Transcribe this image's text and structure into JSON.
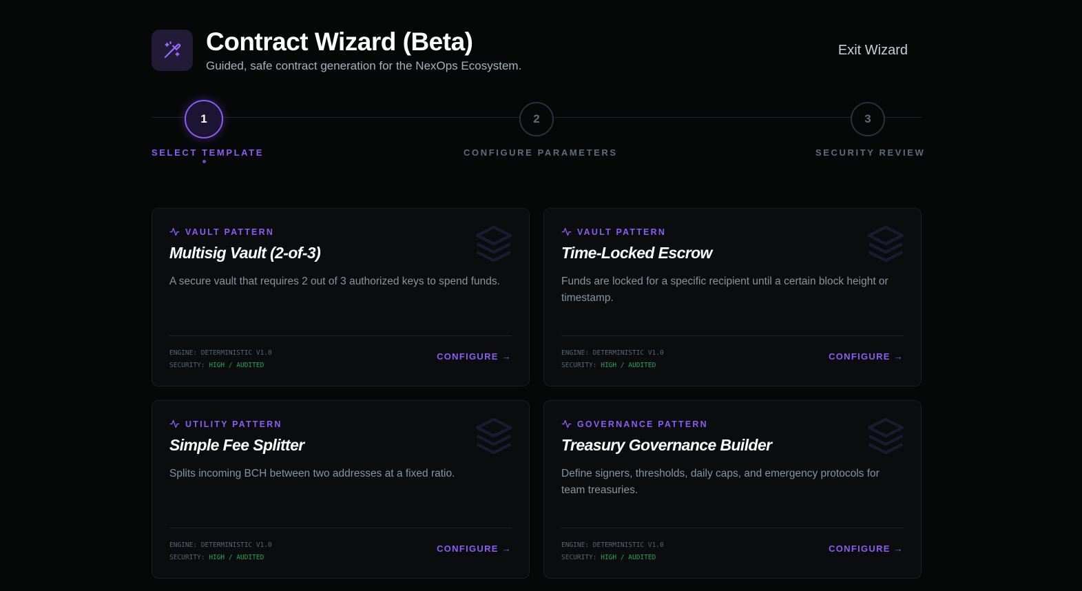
{
  "header": {
    "title": "Contract Wizard (Beta)",
    "subtitle": "Guided, safe contract generation for the NexOps Ecosystem.",
    "exit_label": "Exit Wizard",
    "logo_icon": "magic-wand-icon"
  },
  "stepper": {
    "steps": [
      {
        "number": "1",
        "label": "SELECT TEMPLATE",
        "active": true
      },
      {
        "number": "2",
        "label": "CONFIGURE PARAMETERS",
        "active": false
      },
      {
        "number": "3",
        "label": "SECURITY REVIEW",
        "active": false
      }
    ]
  },
  "cards": [
    {
      "tag": "VAULT PATTERN",
      "title": "Multisig Vault (2-of-3)",
      "description": "A secure vault that requires 2 out of 3 authorized keys to spend funds.",
      "engine_label": "ENGINE:",
      "engine_value": "DETERMINISTIC V1.0",
      "security_label": "SECURITY:",
      "security_value": "HIGH / AUDITED",
      "action": "CONFIGURE →"
    },
    {
      "tag": "VAULT PATTERN",
      "title": "Time-Locked Escrow",
      "description": "Funds are locked for a specific recipient until a certain block height or timestamp.",
      "engine_label": "ENGINE:",
      "engine_value": "DETERMINISTIC V1.0",
      "security_label": "SECURITY:",
      "security_value": "HIGH / AUDITED",
      "action": "CONFIGURE →"
    },
    {
      "tag": "UTILITY PATTERN",
      "title": "Simple Fee Splitter",
      "description": "Splits incoming BCH between two addresses at a fixed ratio.",
      "engine_label": "ENGINE:",
      "engine_value": "DETERMINISTIC V1.0",
      "security_label": "SECURITY:",
      "security_value": "HIGH / AUDITED",
      "action": "CONFIGURE →"
    },
    {
      "tag": "GOVERNANCE PATTERN",
      "title": "Treasury Governance Builder",
      "description": "Define signers, thresholds, daily caps, and emergency protocols for team treasuries.",
      "engine_label": "ENGINE:",
      "engine_value": "DETERMINISTIC V1.0",
      "security_label": "SECURITY:",
      "security_value": "HIGH / AUDITED",
      "action": "CONFIGURE →"
    }
  ],
  "colors": {
    "background": "#060808",
    "accent": "#8b5cf6",
    "success": "#22a55a",
    "muted": "#5f6b7c"
  }
}
